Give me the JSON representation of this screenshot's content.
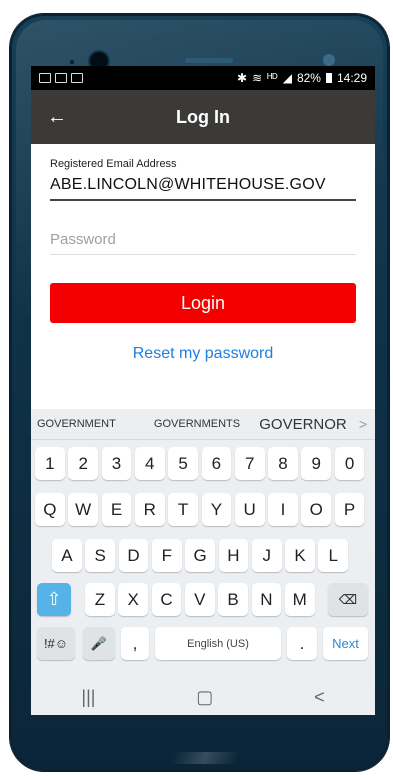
{
  "status_bar": {
    "signal_text": "ᴴᴰ",
    "battery": "82%",
    "time": "14:29"
  },
  "app_bar": {
    "back_icon": "←",
    "title": "Log In"
  },
  "form": {
    "email_label": "Registered Email Address",
    "email_value": "ABE.LINCOLN@WHITEHOUSE.GOV",
    "password_placeholder": "Password",
    "login_label": "Login",
    "reset_label": "Reset my password"
  },
  "keyboard": {
    "suggestions": [
      "GOVERNMENT",
      "GOVERNMENTS",
      "GOVERNOR"
    ],
    "suggest_arrow": ">",
    "row1": [
      "1",
      "2",
      "3",
      "4",
      "5",
      "6",
      "7",
      "8",
      "9",
      "0"
    ],
    "row2": [
      "Q",
      "W",
      "E",
      "R",
      "T",
      "Y",
      "U",
      "I",
      "O",
      "P"
    ],
    "row3": [
      "A",
      "S",
      "D",
      "F",
      "G",
      "H",
      "J",
      "K",
      "L"
    ],
    "row4": [
      "Z",
      "X",
      "C",
      "V",
      "B",
      "N",
      "M"
    ],
    "shift_icon": "⇧",
    "backspace_icon": "⌫",
    "symbols_label": "!#☺",
    "mic_icon": "🎤",
    "comma": ",",
    "space_label": "English (US)",
    "period": ".",
    "next_label": "Next"
  },
  "nav": {
    "recents": "|||",
    "home": "▢",
    "back": "<"
  },
  "colors": {
    "accent": "#f40000",
    "link": "#1f7fe0",
    "appbar": "#3c3a38"
  }
}
